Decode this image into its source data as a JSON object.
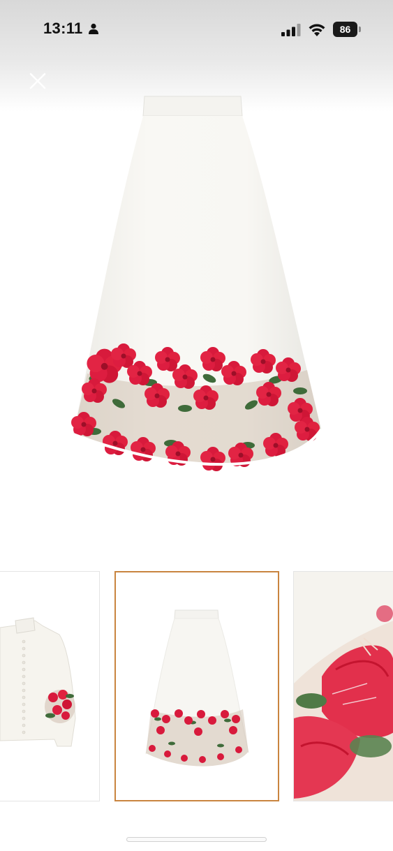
{
  "status_bar": {
    "time": "13:11",
    "battery_level": "86",
    "person_icon": "person-fill-icon",
    "signal_icon": "cellular-signal-icon",
    "wifi_icon": "wifi-icon"
  },
  "viewer": {
    "close_icon": "close-icon",
    "main_image": "white-a-line-midi-skirt-red-hibiscus-border",
    "selected_thumbnail": 2
  },
  "thumbnails": [
    {
      "image": "white-blouse-floral-cuff"
    },
    {
      "image": "white-midi-skirt-floral-hem"
    },
    {
      "image": "skirt-fabric-hibiscus-closeup"
    }
  ],
  "colors": {
    "selection_border": "#c9843f",
    "flower_red": "#d81a3c",
    "leaf_green": "#3f6b3a",
    "fabric_white": "#f7f5f0"
  }
}
